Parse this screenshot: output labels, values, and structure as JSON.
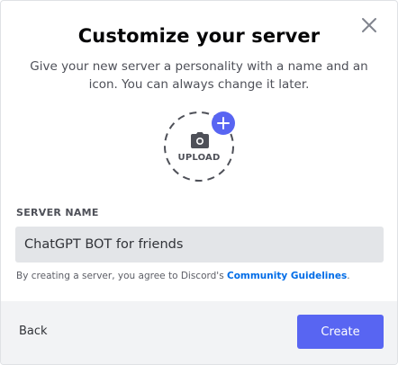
{
  "modal": {
    "title": "Customize your server",
    "subtitle": "Give your new server a personality with a name and an icon. You can always change it later.",
    "close_icon": "close-icon"
  },
  "upload": {
    "label": "UPLOAD",
    "icon": "camera-icon",
    "badge_icon": "plus-icon"
  },
  "server_name": {
    "label": "SERVER NAME",
    "value": "ChatGPT BOT for friends"
  },
  "terms": {
    "prefix": "By creating a server, you agree to Discord's ",
    "link": "Community Guidelines",
    "suffix": "."
  },
  "footer": {
    "back_label": "Back",
    "create_label": "Create"
  },
  "colors": {
    "accent": "#5865f2",
    "link": "#006ce7",
    "input_bg": "#e3e5e8",
    "footer_bg": "#f2f3f5"
  }
}
